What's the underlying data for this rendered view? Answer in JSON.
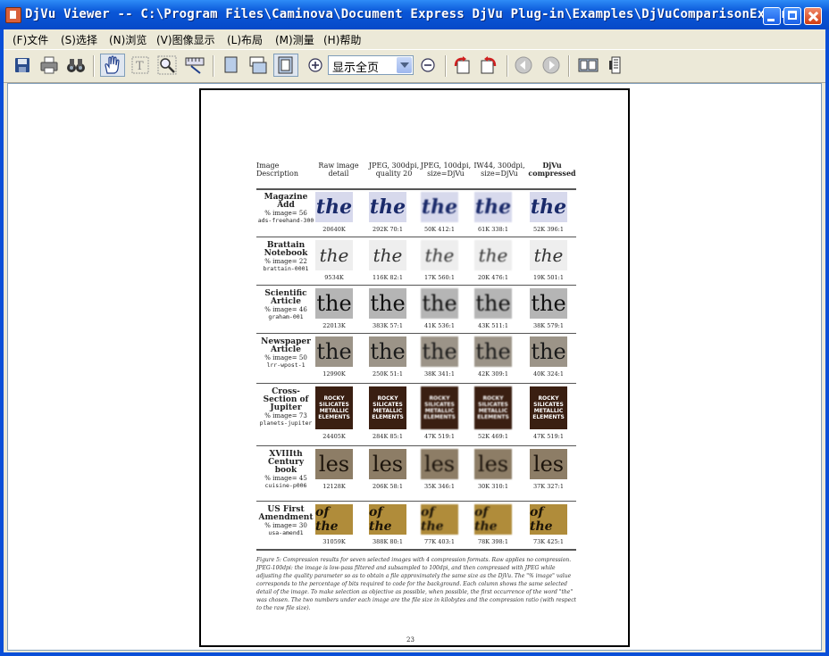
{
  "window": {
    "title": "DjVu Viewer -- C:\\Program Files\\Caminova\\Document Express DjVu Plug-in\\Examples\\DjVuComparisonExcer..."
  },
  "menu": [
    "(F)文件",
    "(S)选择",
    "(N)浏览",
    "(V)图像显示",
    "(L)布局",
    "(M)测量",
    "(H)帮助"
  ],
  "toolbar": {
    "zoom_value": "显示全页"
  },
  "document": {
    "headers": [
      "Image Description",
      "Raw image detail",
      "JPEG, 300dpi, quality 20",
      "JPEG, 100dpi, size=DjVu",
      "IW44, 300dpi, size=DjVu",
      "DjVu compressed"
    ],
    "rows": [
      {
        "name": "Magazine Add",
        "pct": "% image= 56",
        "id": "ads-freehand-300",
        "word": "the",
        "style": "mag",
        "captions": [
          "20640K",
          "292K 70:1",
          "50K 412:1",
          "61K 338:1",
          "52K 396:1"
        ]
      },
      {
        "name": "Brattain Notebook",
        "pct": "% image= 22",
        "id": "brattain-0001",
        "word": "the",
        "style": "hand",
        "captions": [
          "9534K",
          "116K 82:1",
          "17K 560:1",
          "20K 476:1",
          "19K 501:1"
        ]
      },
      {
        "name": "Scientific Article",
        "pct": "% image= 46",
        "id": "graham-001",
        "word": "the",
        "style": "sci",
        "captions": [
          "22013K",
          "383K 57:1",
          "41K 536:1",
          "43K 511:1",
          "38K 579:1"
        ]
      },
      {
        "name": "Newspaper Article",
        "pct": "% image= 50",
        "id": "lrr-wpost-1",
        "word": "the",
        "style": "news",
        "captions": [
          "12990K",
          "250K 51:1",
          "38K 341:1",
          "42K 309:1",
          "40K 324:1"
        ]
      },
      {
        "name": "Cross-Section of Jupiter",
        "pct": "% image= 73",
        "id": "planets-jupiter",
        "word": "ROCKY SILICATES METALLIC ELEMENTS",
        "style": "jup",
        "captions": [
          "24405K",
          "284K 85:1",
          "47K 519:1",
          "52K 469:1",
          "47K 519:1"
        ]
      },
      {
        "name": "XVIIIth Century book",
        "pct": "% image= 45",
        "id": "cuisine-p006",
        "word": "les",
        "style": "book",
        "captions": [
          "12128K",
          "206K 58:1",
          "35K 346:1",
          "30K 310:1",
          "37K 327:1"
        ]
      },
      {
        "name": "US First Amendment",
        "pct": "% image= 30",
        "id": "usa-amend1",
        "word": "of the",
        "style": "amend",
        "captions": [
          "31059K",
          "388K 80:1",
          "77K 403:1",
          "78K 398:1",
          "73K 425:1"
        ]
      }
    ],
    "caption": "Figure 5: Compression results for seven selected images with 4 compression formats. Raw applies no compression. JPEG-100dpi: the image is low-pass filtered and subsampled to 100dpi, and then compressed with JPEG while adjusting the quality parameter so as to obtain a file approximately the same size as the DjVu. The \"% image\" value corresponds to the percentage of bits required to code for the background. Each column shows the same selected detail of the image. To make selection as objective as possible, when possible, the first occurrence of the word \"the\" was chosen. The two numbers under each image are the file size in kilobytes and the compression ratio (with respect to the raw file size).",
    "page_number": "23"
  }
}
